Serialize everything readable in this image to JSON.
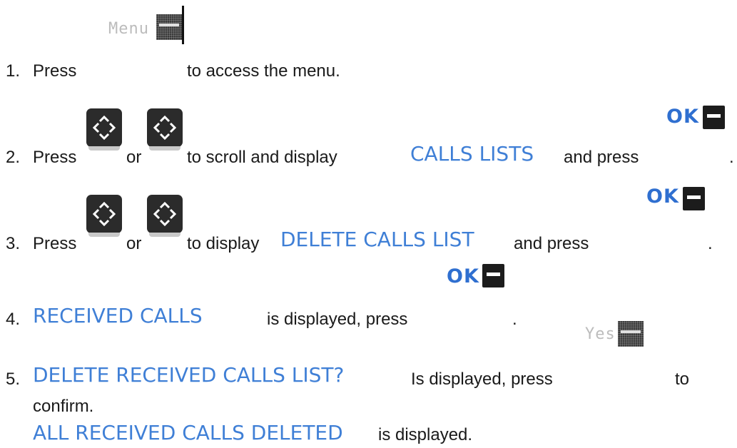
{
  "steps": [
    {
      "num": "1.",
      "press": "Press",
      "key_label": "Menu",
      "after": "to access the menu."
    },
    {
      "num": "2.",
      "press": "Press",
      "or": "or",
      "middle": "to scroll and display",
      "highlight": "CALLS  LISTS",
      "and_press": "and press",
      "ok_label": "OK",
      "end": "."
    },
    {
      "num": "3.",
      "press": "Press",
      "or": "or",
      "middle": "to display",
      "highlight": "DELETE CALLS LIST",
      "and_press": "and press",
      "ok_label": "OK",
      "end": "."
    },
    {
      "num": "4.",
      "highlight": "RECEIVED CALLS",
      "middle": "is displayed, press",
      "ok_label": "OK",
      "end": "."
    },
    {
      "num": "5.",
      "highlight": "DELETE RECEIVED CALLS LIST?",
      "middle": "Is displayed, press",
      "key_label": "Yes",
      "after": "to",
      "continuation": "confirm."
    }
  ],
  "result": {
    "highlight": "ALL RECEIVED CALLS DELETED",
    "after": "is displayed."
  },
  "icons": {
    "menu_key": "pixelated-softkey-icon",
    "nav_key": "navigation-key-icon",
    "ok_key": "ok-softkey-icon",
    "yes_key": "pixelated-softkey-icon"
  },
  "colors": {
    "highlight": "#3f7fd6",
    "ok_label": "#2f6fd0",
    "text": "#1a1a1a"
  }
}
